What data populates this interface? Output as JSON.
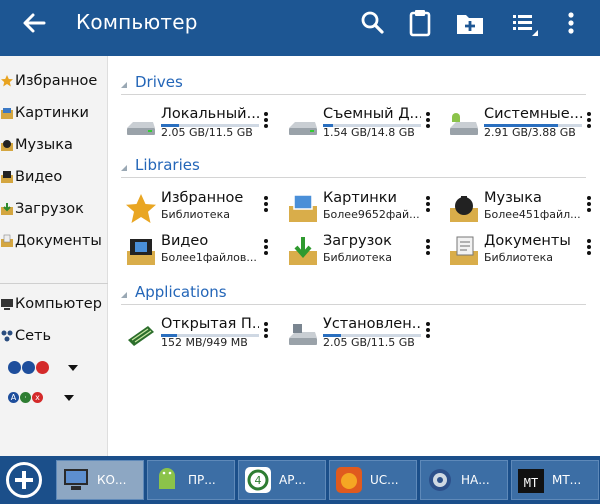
{
  "appbar": {
    "title": "Компьютер",
    "icons": [
      "back-arrow-icon",
      "search-icon",
      "clipboard-icon",
      "new-folder-icon",
      "list-view-icon",
      "more-vert-icon"
    ],
    "color": "#1d5693"
  },
  "sidebar": {
    "items": [
      {
        "label": "Избранное",
        "icon": "star-icon"
      },
      {
        "label": "Картинки",
        "icon": "pictures-icon"
      },
      {
        "label": "Музыка",
        "icon": "music-icon"
      },
      {
        "label": "Видео",
        "icon": "video-icon"
      },
      {
        "label": "Загрузок",
        "icon": "downloads-icon"
      },
      {
        "label": "Документы",
        "icon": "documents-icon"
      },
      {
        "label": "Компьютер",
        "icon": "computer-icon"
      },
      {
        "label": "Сеть",
        "icon": "network-icon"
      }
    ]
  },
  "sections": {
    "drives": {
      "title": "Drives",
      "items": [
        {
          "name": "Локальный...",
          "sub": "2.05 GB/11.5 GB",
          "usage": 0.18
        },
        {
          "name": "Съемный Д...",
          "sub": "1.54 GB/14.8 GB",
          "usage": 0.1
        },
        {
          "name": "Системные...",
          "sub": "2.91 GB/3.88 GB",
          "usage": 0.75
        }
      ]
    },
    "libraries": {
      "title": "Libraries",
      "items": [
        {
          "name": "Избранное",
          "sub": "Библиотека"
        },
        {
          "name": "Картинки",
          "sub": "Более9652фай..."
        },
        {
          "name": "Музыка",
          "sub": "Более451файл..."
        },
        {
          "name": "Видео",
          "sub": "Более1файлов..."
        },
        {
          "name": "Загрузок",
          "sub": "Библиотека"
        },
        {
          "name": "Документы",
          "sub": "Библиотека"
        }
      ]
    },
    "applications": {
      "title": "Applications",
      "items": [
        {
          "name": "Открытая П...",
          "sub": "152 MB/949 MB",
          "usage": 0.16
        },
        {
          "name": "Установлен...",
          "sub": "2.05 GB/11.5 GB",
          "usage": 0.18
        }
      ]
    }
  },
  "taskbar": {
    "tasks": [
      {
        "label": "КО...",
        "icon": "computer-icon",
        "active": true
      },
      {
        "label": "ПР...",
        "icon": "android-icon"
      },
      {
        "label": "АР...",
        "icon": "apk-icon"
      },
      {
        "label": "UC...",
        "icon": "uc-browser-icon"
      },
      {
        "label": "НА...",
        "icon": "settings-gear-icon"
      },
      {
        "label": "МТ...",
        "icon": "mt-icon"
      }
    ]
  }
}
